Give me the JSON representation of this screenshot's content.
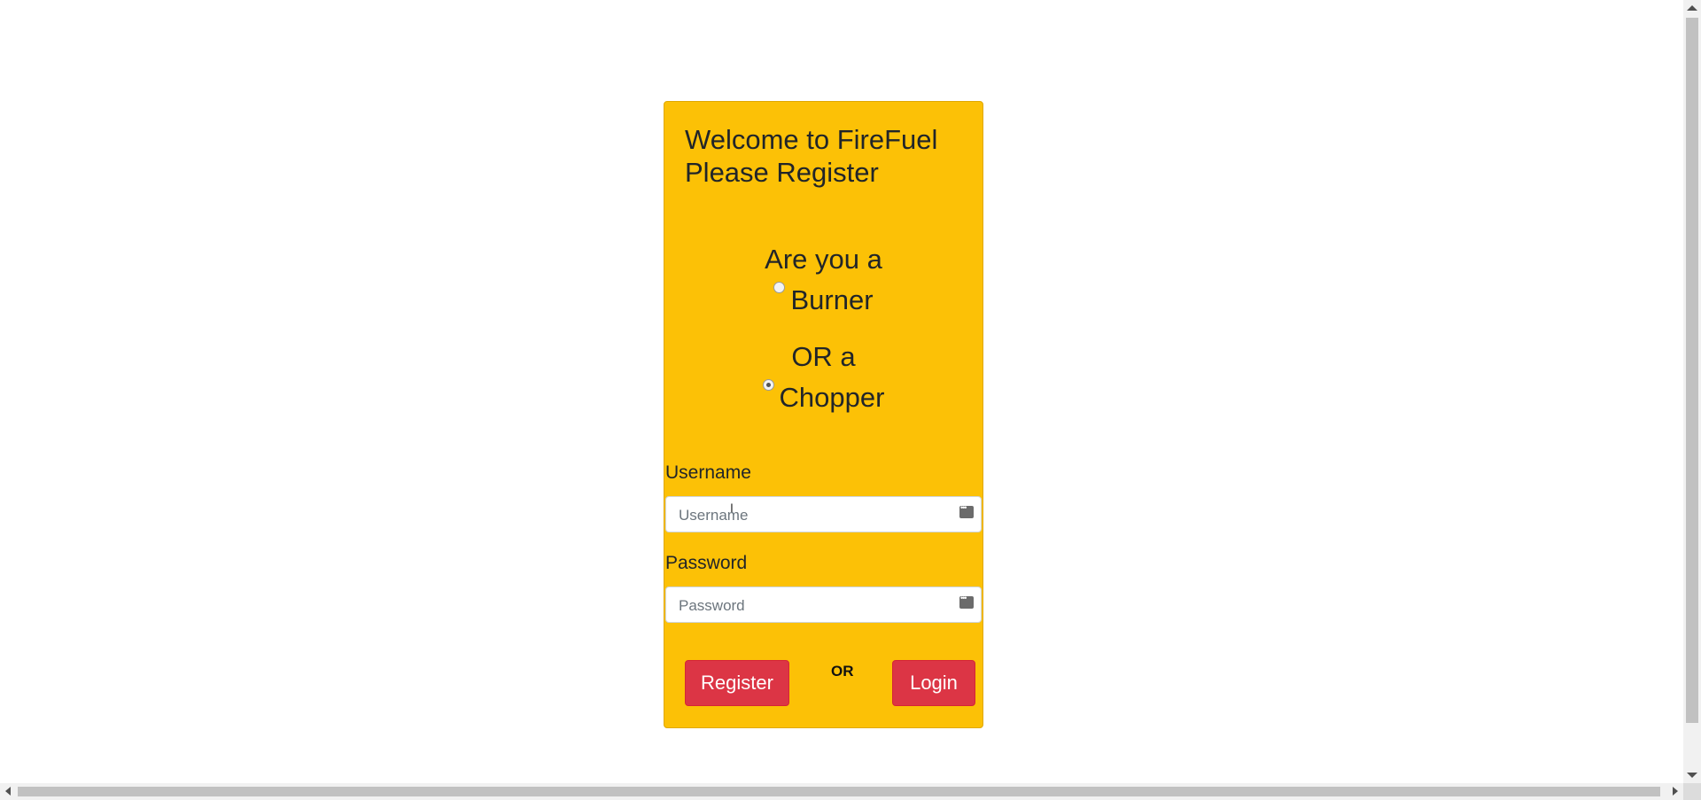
{
  "card": {
    "title_line1": "Welcome to FireFuel",
    "title_line2": "Please Register",
    "question1": "Are you a",
    "option1": "Burner",
    "question2": "OR a",
    "option2": "Chopper",
    "selected_option": "Chopper"
  },
  "form": {
    "username_label": "Username",
    "username_placeholder": "Username",
    "username_value": "",
    "password_label": "Password",
    "password_placeholder": "Password",
    "password_value": ""
  },
  "actions": {
    "register_label": "Register",
    "or_label": "OR",
    "login_label": "Login"
  },
  "colors": {
    "card_bg": "#fcc106",
    "button_bg": "#dc3545"
  }
}
